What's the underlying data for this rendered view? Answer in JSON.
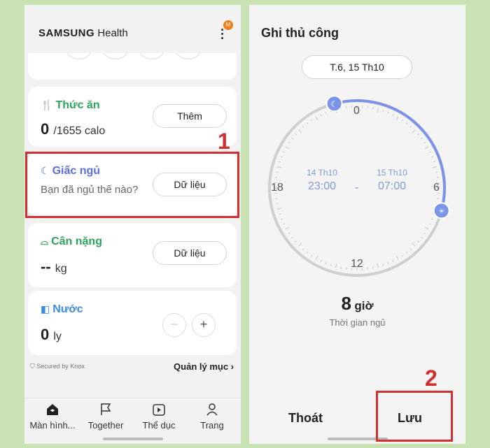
{
  "left": {
    "app_title_bold": "SAMSUNG",
    "app_title_rest": "Health",
    "badge_letter": "M",
    "cards": {
      "food": {
        "title": "Thức ăn",
        "value": "0",
        "unit": "/1655 calo",
        "button": "Thêm",
        "color": "#2aa55a"
      },
      "sleep": {
        "title": "Giấc ngủ",
        "question": "Bạn đã ngủ thế nào?",
        "button": "Dữ liệu",
        "color": "#5a6ee6"
      },
      "weight": {
        "title": "Cân nặng",
        "value": "--",
        "unit": "kg",
        "button": "Dữ liệu",
        "color": "#2aa55a"
      },
      "water": {
        "title": "Nước",
        "value": "0",
        "unit": "ly",
        "minus": "−",
        "plus": "+",
        "color": "#3b8be0"
      }
    },
    "footer": {
      "knox": "Secured by Knox",
      "manage": "Quản lý mục ›"
    },
    "nav": [
      {
        "label": "Màn hình...",
        "icon": "home-icon"
      },
      {
        "label": "Together",
        "icon": "flag-icon"
      },
      {
        "label": "Thể dục",
        "icon": "exercise-icon"
      },
      {
        "label": "Trang",
        "icon": "person-icon"
      }
    ],
    "annotation": "1"
  },
  "right": {
    "title": "Ghi thủ công",
    "date": "T.6, 15 Th10",
    "dial_labels": {
      "top": "0",
      "right": "6",
      "bottom": "12",
      "left": "18"
    },
    "bedtime": {
      "date": "14 Th10",
      "time": "23:00"
    },
    "separator": "-",
    "wake": {
      "date": "15 Th10",
      "time": "07:00"
    },
    "duration": {
      "value": "8",
      "unit": "giờ",
      "label": "Thời gian ngủ"
    },
    "actions": {
      "cancel": "Thoát",
      "save": "Lưu"
    },
    "annotation": "2",
    "arc_color": "#7b93e8"
  }
}
